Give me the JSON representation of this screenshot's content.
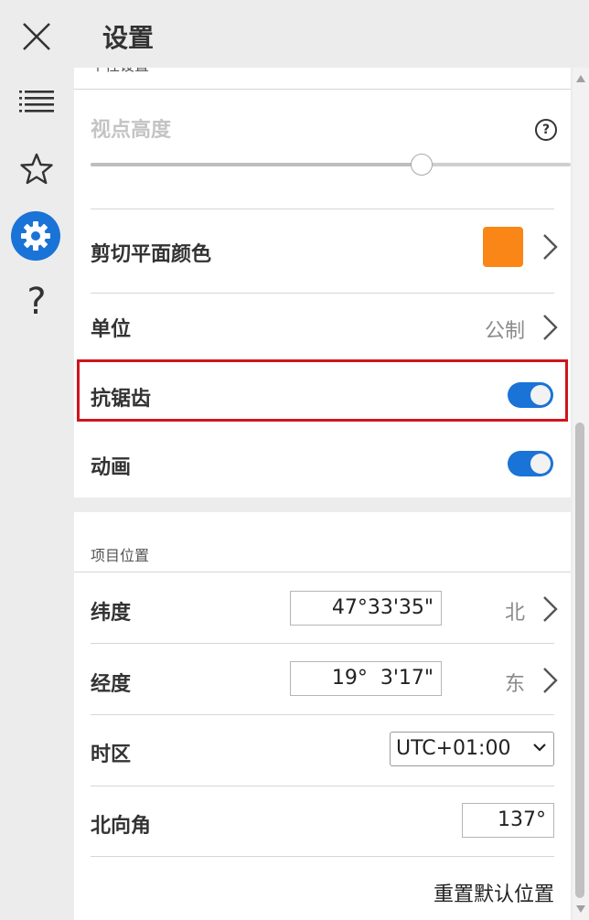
{
  "colors": {
    "accent": "#1a73d6",
    "highlight": "#d0141c",
    "section_color": "#f98616"
  },
  "nav": {
    "items": [
      {
        "name": "close",
        "icon": "close-icon"
      },
      {
        "name": "list",
        "icon": "list-icon"
      },
      {
        "name": "favorites",
        "icon": "star-icon"
      },
      {
        "name": "settings",
        "icon": "gear-icon",
        "active": true
      },
      {
        "name": "help",
        "icon": "question-icon",
        "label": "?"
      }
    ]
  },
  "header": {
    "title": "设置"
  },
  "personalization": {
    "section_title": "个性设置",
    "view_height": {
      "label": "视点高度",
      "help_label": "?",
      "slider_level": 0.69,
      "disabled": true
    },
    "section_plane_color": {
      "label": "剪切平面颜色",
      "color": "#f98616"
    },
    "units": {
      "label": "单位",
      "value": "公制"
    },
    "antialiasing": {
      "label": "抗锯齿",
      "on": true
    },
    "animation": {
      "label": "动画",
      "on": true
    }
  },
  "project_location": {
    "section_title": "项目位置",
    "latitude": {
      "label": "纬度",
      "value": "47°33'35\"",
      "hemisphere": "北"
    },
    "longitude": {
      "label": "经度",
      "value": "19°  3'17\"",
      "hemisphere": "东"
    },
    "timezone": {
      "label": "时区",
      "value": "UTC+01:00"
    },
    "north_angle": {
      "label": "北向角",
      "value": "137°"
    },
    "reset_label": "重置默认位置"
  }
}
